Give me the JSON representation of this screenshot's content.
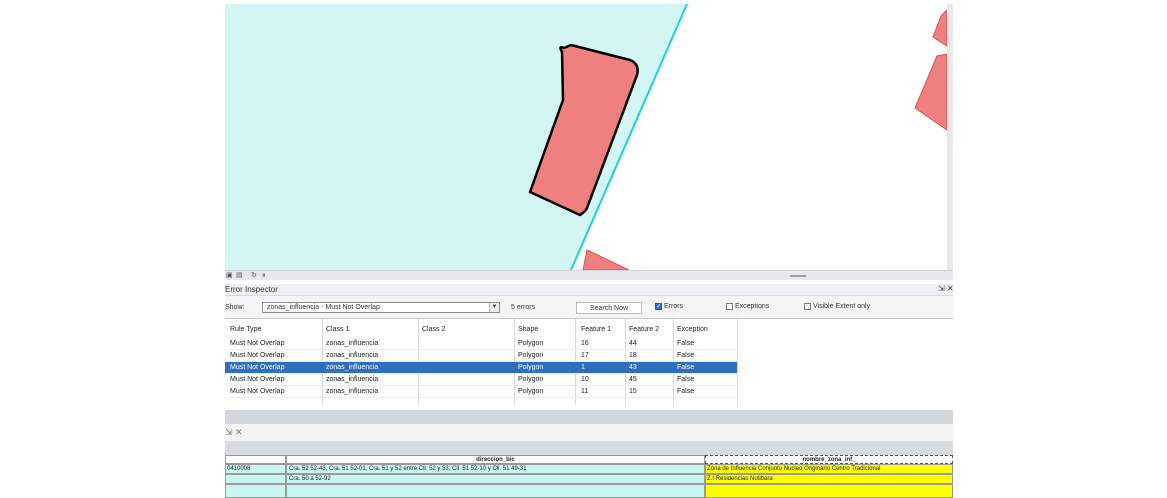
{
  "map": {
    "colors": {
      "aqua_zone": "#d3f6f4",
      "feature_fill": "#f08080",
      "divider_line": "#18d4d4",
      "white_area": "#ffffff"
    }
  },
  "error_inspector": {
    "title": "Error Inspector",
    "show_label": "Show:",
    "rule_dropdown_value": "zonas_influencia - Must Not Overlap",
    "error_count": "5 errors",
    "search_button": "Search Now",
    "checkboxes": [
      {
        "label": "Errors",
        "checked": true
      },
      {
        "label": "Exceptions",
        "checked": false
      },
      {
        "label": "Visible Extent only",
        "checked": false
      }
    ],
    "columns": [
      "Rule Type",
      "Class 1",
      "Class 2",
      "Shape",
      "Feature 1",
      "Feature 2",
      "Exception"
    ],
    "rows": [
      {
        "rule": "Must Not Overlap",
        "class1": "zonas_influencia",
        "class2": "",
        "shape": "Polygon",
        "f1": "16",
        "f2": "44",
        "exception": "False",
        "selected": false
      },
      {
        "rule": "Must Not Overlap",
        "class1": "zonas_influencia",
        "class2": "",
        "shape": "Polygon",
        "f1": "17",
        "f2": "18",
        "exception": "False",
        "selected": false
      },
      {
        "rule": "Must Not Overlap",
        "class1": "zonas_influencia",
        "class2": "",
        "shape": "Polygon",
        "f1": "1",
        "f2": "43",
        "exception": "False",
        "selected": true
      },
      {
        "rule": "Must Not Overlap",
        "class1": "zonas_influencia",
        "class2": "",
        "shape": "Polygon",
        "f1": "10",
        "f2": "45",
        "exception": "False",
        "selected": false
      },
      {
        "rule": "Must Not Overlap",
        "class1": "zonas_influencia",
        "class2": "",
        "shape": "Polygon",
        "f1": "11",
        "f2": "15",
        "exception": "False",
        "selected": false
      }
    ]
  },
  "attribute_table": {
    "headers": [
      "",
      "direccion_bic",
      "nombre_zona_inf_"
    ],
    "rows": [
      [
        "0410008",
        "Cra. 52 52-43, Cra. 51 52-01, Cra. 51 y 52 entre Cll. 52 y 53, Cll. 51 52-10 y Cll. 51 49-31",
        "Zona de Influencia Conjunto Nucleo Originario Centro Tradicional"
      ],
      [
        "",
        "Cra. 50 a 52-92",
        "Z.I Residencias Nutibara"
      ],
      [
        "",
        "",
        ""
      ]
    ],
    "colors": {
      "aqua": "#c9f6f3",
      "yellow": "#ffff00"
    }
  }
}
